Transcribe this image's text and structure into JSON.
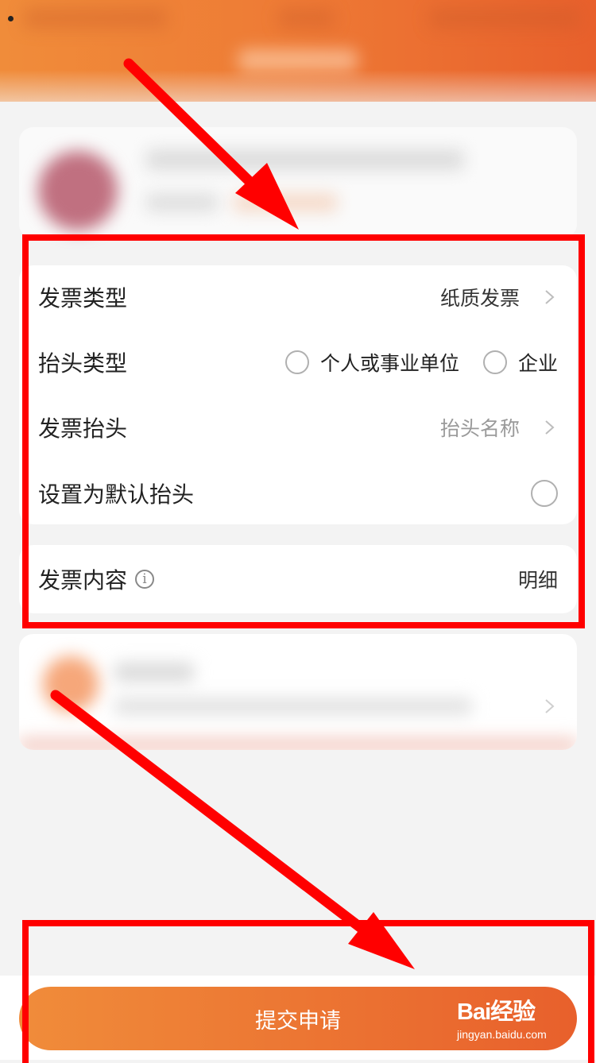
{
  "invoice": {
    "type_label": "发票类型",
    "type_value": "纸质发票",
    "header_type_label": "抬头类型",
    "header_type_options": [
      "个人或事业单位",
      "企业"
    ],
    "invoice_header_label": "发票抬头",
    "invoice_header_placeholder": "抬头名称",
    "default_header_label": "设置为默认抬头",
    "content_label": "发票内容",
    "content_value": "明细"
  },
  "footer": {
    "submit_label": "提交申请"
  },
  "watermark": {
    "brand_line": "Bai经验",
    "url": "jingyan.baidu.com"
  },
  "colors": {
    "accent_start": "#f08c3a",
    "accent_end": "#e8602c",
    "annotation_red": "#ff0000"
  }
}
